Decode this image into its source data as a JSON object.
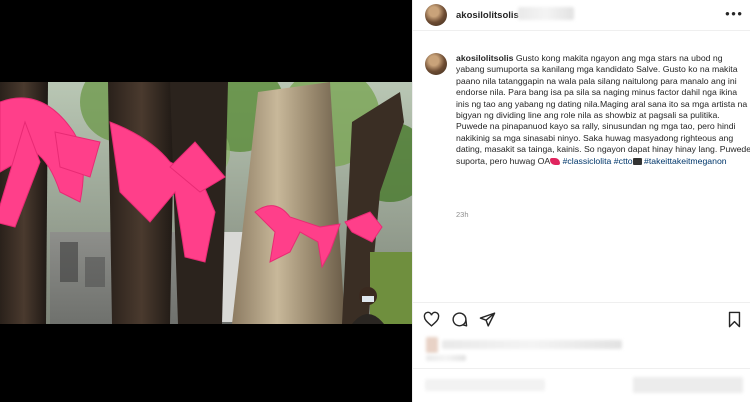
{
  "post": {
    "username": "akosilolitsolis",
    "more_icon": "more-horizontal-icon",
    "caption": {
      "username": "akosilolitsolis",
      "text": "Gusto kong makita ngayon ang mga stars na ubod ng yabang sumuporta sa kanilang mga kandidato Salve. Gusto ko na makita paano nila tatanggapin na wala pala silang naitulong para manalo ang ini endorse nila. Para bang isa pa sila sa naging minus factor dahil nga ikina inis ng tao ang yabang ng dating nila.Maging aral sana ito sa mga artista na bigyan ng dividing line ang role nila as showbiz at pagsali sa pulitika. Puwede na pinapanuod kayo sa rally, sinusundan ng mga tao, pero hindi nakikinig sa mga sinasabi ninyo. Saka huwag masyadong righteous ang dating, masakit sa tainga, kainis. So ngayon dapat hinay hinay lang. Puwede suporta, pero huwag OA",
      "hashtag_1": "#classiclolita",
      "hashtag_2": "#ctto",
      "hashtag_3": "#takeittakeitmeganon"
    },
    "timestamp": "23h"
  },
  "actions": {
    "like_icon": "heart-icon",
    "comment_icon": "comment-icon",
    "share_icon": "share-icon",
    "save_icon": "bookmark-icon"
  },
  "colors": {
    "ribbon": "#ff3f8a",
    "link": "#00376b",
    "muted": "#8e8e8e",
    "divider": "#efefef"
  }
}
